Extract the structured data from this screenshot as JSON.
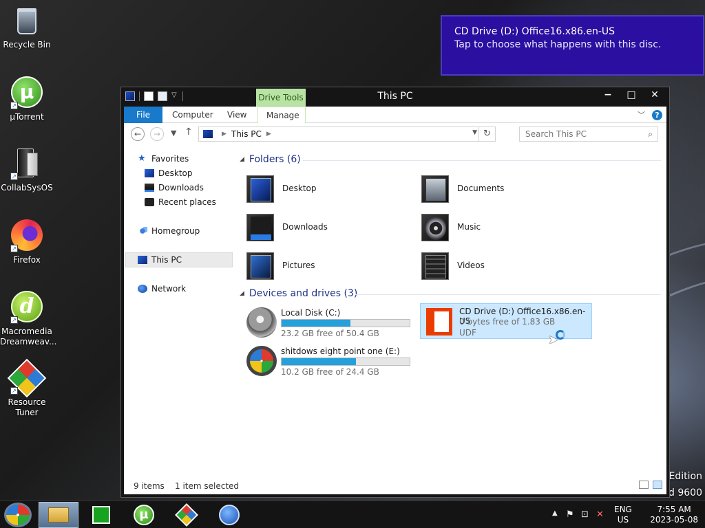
{
  "desktop": {
    "icons": [
      {
        "label": "Recycle Bin"
      },
      {
        "label": "µTorrent"
      },
      {
        "label": "CollabSysOS"
      },
      {
        "label": "Firefox"
      },
      {
        "label": "Macromedia Dreamweav..."
      },
      {
        "label": "Resource Tuner"
      }
    ],
    "edition_line1": "Edition",
    "edition_line2": "d 9600"
  },
  "toast": {
    "title": "CD Drive (D:) Office16.x86.en-US",
    "message": "Tap to choose what happens with this disc."
  },
  "window": {
    "title": "This PC",
    "context_tab": "Drive Tools",
    "ribbon_tabs": {
      "file": "File",
      "computer": "Computer",
      "view": "View",
      "manage": "Manage"
    },
    "address": {
      "location": "This PC"
    },
    "search": {
      "placeholder": "Search This PC"
    },
    "nav": {
      "favorites": "Favorites",
      "desktop": "Desktop",
      "downloads": "Downloads",
      "recent": "Recent places",
      "homegroup": "Homegroup",
      "this_pc": "This PC",
      "network": "Network"
    },
    "folders_header": "Folders (6)",
    "folders": [
      {
        "name": "Desktop"
      },
      {
        "name": "Documents"
      },
      {
        "name": "Downloads"
      },
      {
        "name": "Music"
      },
      {
        "name": "Pictures"
      },
      {
        "name": "Videos"
      }
    ],
    "drives_header": "Devices and drives (3)",
    "drives": [
      {
        "name": "Local Disk (C:)",
        "free": "23.2 GB free of 50.4 GB",
        "used_fraction": 0.54
      },
      {
        "name": "shitdows eight point one (E:)",
        "free": "10.2 GB free of 24.4 GB",
        "used_fraction": 0.58
      }
    ],
    "cd_drive": {
      "name": "CD Drive (D:) Office16.x86.en-US",
      "free": "0 bytes free of 1.83 GB",
      "fs": "UDF"
    },
    "status": {
      "items": "9 items",
      "selected": "1 item selected"
    }
  },
  "taskbar": {
    "lang": "ENG",
    "region": "US",
    "time": "7:55 AM",
    "date": "2023-05-08"
  }
}
